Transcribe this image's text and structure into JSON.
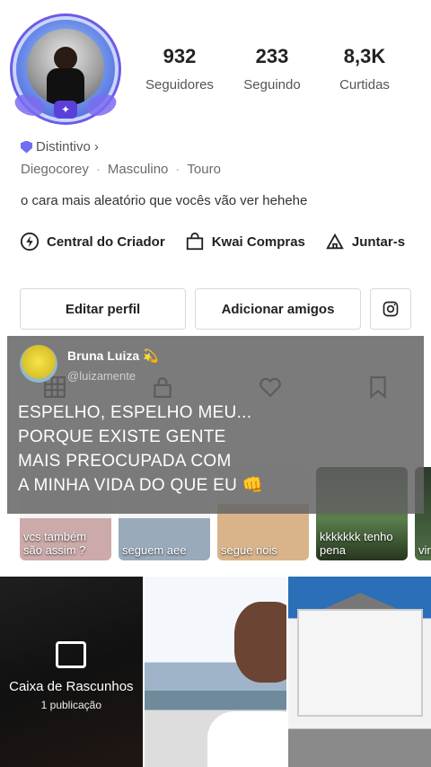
{
  "profile": {
    "stats": [
      {
        "value": "932",
        "label": "Seguidores"
      },
      {
        "value": "233",
        "label": "Seguindo"
      },
      {
        "value": "8,3K",
        "label": "Curtidas"
      }
    ],
    "badge_label": "Distintivo",
    "badge_chevron": "›",
    "username": "Diegocorey",
    "gender": "Masculino",
    "sign": "Touro",
    "bio": "o cara mais aleatório que vocês vão ver hehehe"
  },
  "links": {
    "creator": "Central do Criador",
    "shop": "Kwai Compras",
    "join": "Juntar-s"
  },
  "buttons": {
    "edit": "Editar perfil",
    "add_friends": "Adicionar amigos"
  },
  "overlay": {
    "name": "Bruna Luiza 💫",
    "handle": "@luizamente",
    "text": "ESPELHO, ESPELHO MEU...\nPORQUE EXISTE GENTE\nMAIS PREOCUPADA COM\nA MINHA VIDA DO QUE EU 👊"
  },
  "chips": [
    {
      "caption": "vcs também\nsão assim ?"
    },
    {
      "caption": "seguem aee"
    },
    {
      "caption": "segue nois"
    },
    {
      "caption": "kkkkkkk tenho\npena"
    },
    {
      "caption": "vir"
    }
  ],
  "drafts": {
    "title": "Caixa de Rascunhos",
    "count": "1 publicação"
  },
  "colors": {
    "accent": "#5b3fd9",
    "overlay_bg": "#646464"
  }
}
